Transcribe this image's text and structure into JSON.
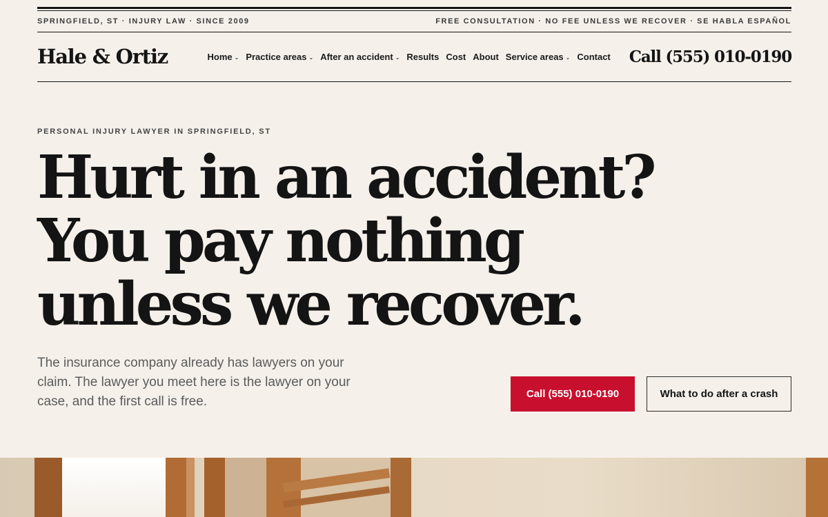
{
  "utility": {
    "left": "SPRINGFIELD, ST · INJURY LAW · SINCE 2009",
    "right": "FREE CONSULTATION · NO FEE UNLESS WE RECOVER · SE HABLA ESPAÑOL"
  },
  "nav": {
    "logo": "Hale & Ortiz",
    "items": [
      {
        "label": "Home",
        "dropdown": true
      },
      {
        "label": "Practice areas",
        "dropdown": true
      },
      {
        "label": "After an accident",
        "dropdown": true
      },
      {
        "label": "Results",
        "dropdown": false
      },
      {
        "label": "Cost",
        "dropdown": false
      },
      {
        "label": "About",
        "dropdown": false
      },
      {
        "label": "Service areas",
        "dropdown": true
      },
      {
        "label": "Contact",
        "dropdown": false
      }
    ],
    "dropdown_icon": "chevron-down-icon",
    "phone": "Call (555) 010-0190"
  },
  "hero": {
    "eyebrow": "PERSONAL INJURY LAWYER IN SPRINGFIELD, ST",
    "headline": [
      "Hurt in an accident?",
      "You pay nothing",
      "unless we recover."
    ],
    "lede": "The insurance company already has lawyers on your claim. The lawyer you meet here is the lawyer on your case, and the first call is free.",
    "primary_cta": "Call (555) 010-0190",
    "secondary_cta": "What to do after a crash"
  },
  "colors": {
    "background": "#f5f0ea",
    "text": "#141414",
    "accent": "#c8102e"
  }
}
